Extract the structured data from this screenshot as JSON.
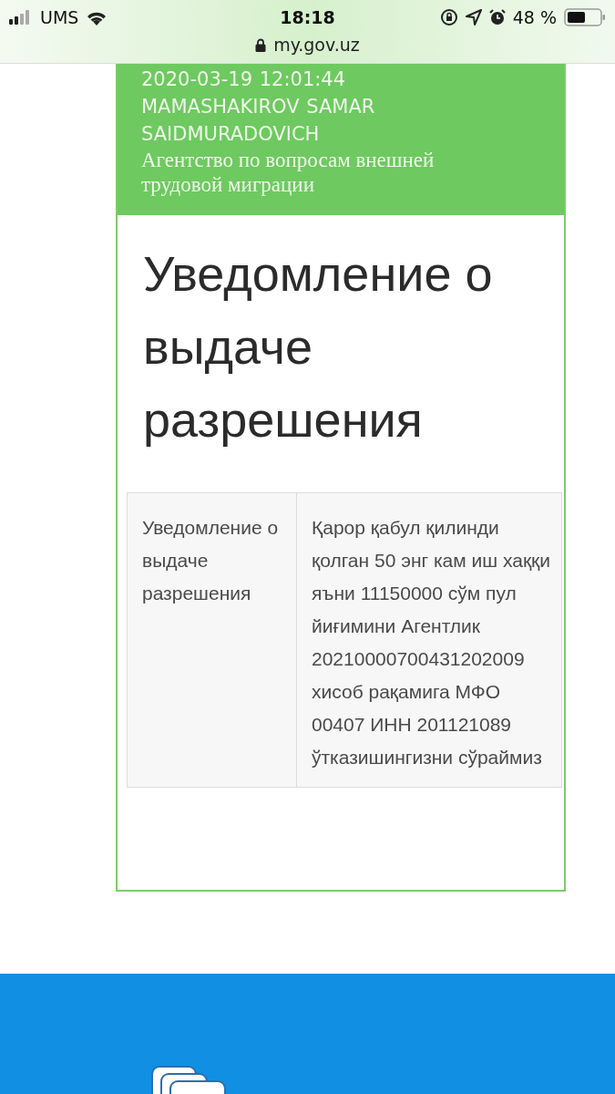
{
  "status_bar": {
    "carrier": "UMS",
    "time": "18:18",
    "battery_text": "48 %"
  },
  "address_bar": {
    "url": "my.gov.uz"
  },
  "card": {
    "header": {
      "meta": "2020-03-19 12:01:44   MAMASHAKIROV SAMAR SAIDMURADOVICH",
      "organization": "Агентство по вопросам внешней трудовой миграции"
    },
    "title": "Уведомление о выдаче разрешения",
    "table": {
      "rows": [
        {
          "label": "Уведомление о выдаче разрешения",
          "value": "Қарор қабул қилинди қолган 50 энг кам иш хаққи яъни 11150000 сўм пул йиғимини Агентлик 20210000700431202009 хисоб рақамига МФО 00407 ИНН 201121089 ўтказишингизни сўраймиз"
        }
      ]
    }
  }
}
